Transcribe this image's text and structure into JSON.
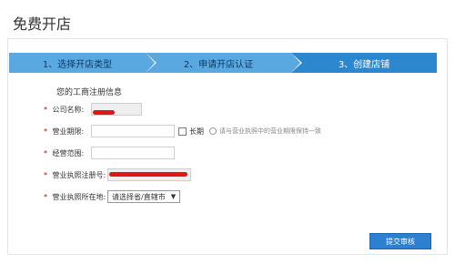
{
  "header": {
    "title": "免费开店"
  },
  "steps": [
    {
      "label": "1、选择开店类型"
    },
    {
      "label": "2、申请开店认证"
    },
    {
      "label": "3、创建店铺"
    }
  ],
  "form": {
    "section_title": "您的工商注册信息",
    "company_name": {
      "label": "公司名称:",
      "required": true
    },
    "business_term": {
      "label": "营业期限:",
      "required": true,
      "checkbox_label": "长期",
      "hint": "请与营业执照中的营业期限保持一致"
    },
    "business_scope": {
      "label": "经营范围:",
      "required": true
    },
    "license_number": {
      "label": "营业执照注册号:",
      "required": true
    },
    "license_location": {
      "label": "营业执照所在地:",
      "required": true,
      "selected": "请选择省/直辖市"
    }
  },
  "footer": {
    "submit_label": "提交审核"
  },
  "colors": {
    "steps_bg": "#5aa8e0",
    "active_step_bg": "#2d87cf",
    "required": "#cc0000",
    "redaction": "#e01515",
    "submit_bg": "#2d7fcf"
  }
}
